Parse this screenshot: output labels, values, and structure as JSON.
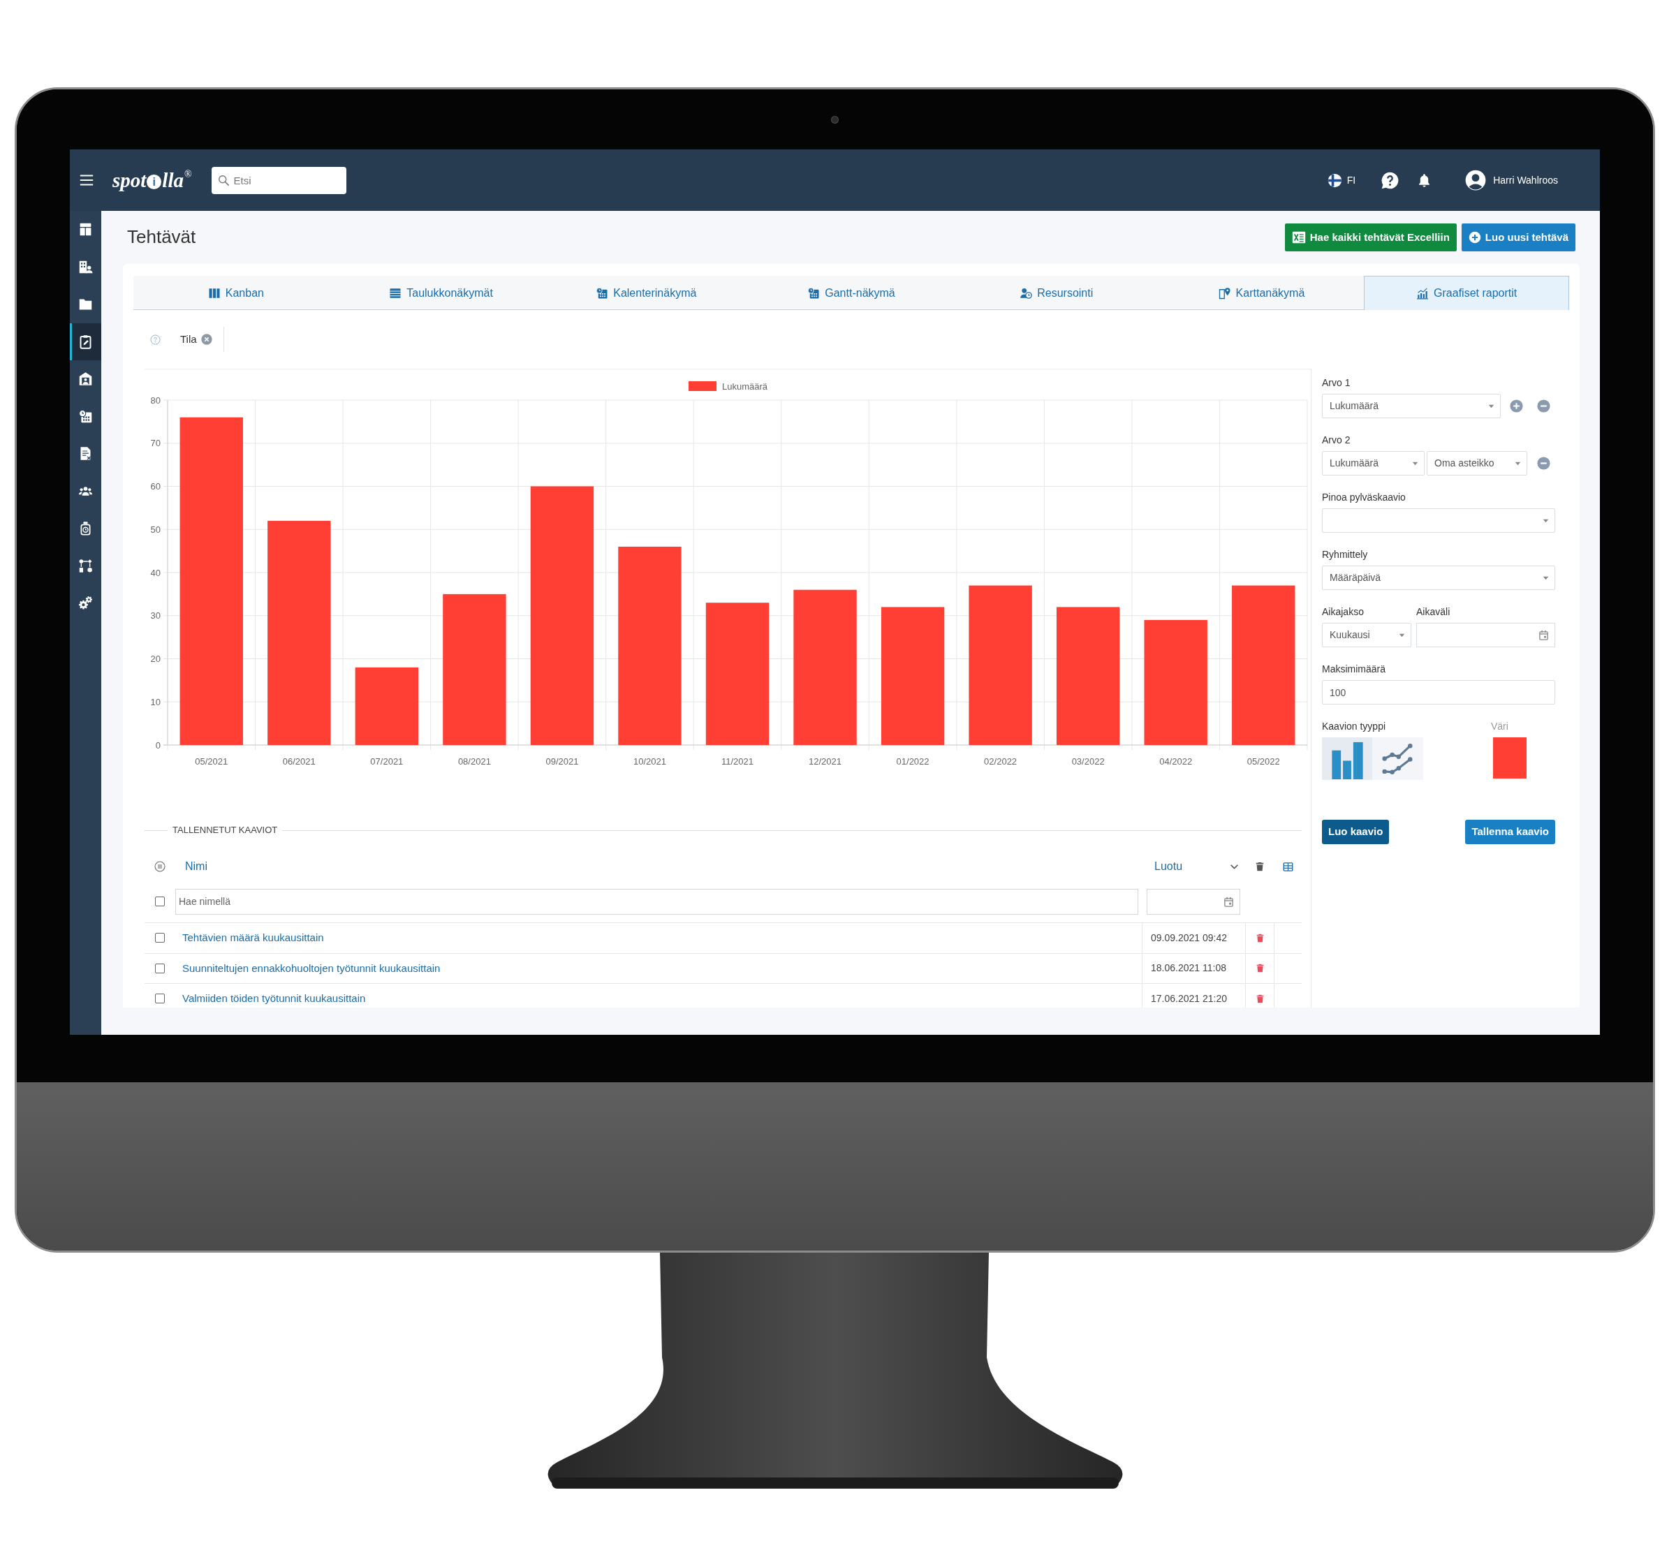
{
  "navbar": {
    "logo": {
      "parts": [
        {
          "text": "spot",
          "kind": "plain"
        },
        {
          "text": "i",
          "kind": "circled"
        },
        {
          "text": "lla",
          "kind": "plain"
        }
      ],
      "mark": "®"
    },
    "search": {
      "placeholder": "Etsi"
    },
    "language": "FI",
    "user": "Harri Wahlroos"
  },
  "sidebar": {
    "items": [
      {
        "selected": false
      },
      {
        "selected": false
      },
      {
        "selected": false
      },
      {
        "selected": true
      },
      {
        "selected": false
      },
      {
        "selected": false
      },
      {
        "selected": false
      },
      {
        "selected": false
      },
      {
        "selected": false
      },
      {
        "selected": false
      },
      {
        "selected": false
      }
    ]
  },
  "header": {
    "title": "Tehtävät",
    "buttons": [
      {
        "label": "Hae kaikki tehtävät Excelliin",
        "kind": "excel"
      },
      {
        "label": "Luo uusi tehtävä",
        "kind": "create"
      }
    ]
  },
  "tabs": [
    {
      "label": "Kanban",
      "selected": false
    },
    {
      "label": "Taulukkonäkymät",
      "selected": false
    },
    {
      "label": "Kalenterinäkymä",
      "selected": false
    },
    {
      "label": "Gantt-näkymä",
      "selected": false
    },
    {
      "label": "Resursointi",
      "selected": false
    },
    {
      "label": "Karttanäkymä",
      "selected": false
    },
    {
      "label": "Graafiset raportit",
      "selected": true
    }
  ],
  "filters": [
    {
      "label": "Tila"
    }
  ],
  "chart": {
    "chart_data": {
      "type": "bar",
      "categories": [
        "05/2021",
        "06/2021",
        "07/2021",
        "08/2021",
        "09/2021",
        "10/2021",
        "11/2021",
        "12/2021",
        "01/2022",
        "02/2022",
        "03/2022",
        "04/2022",
        "05/2022"
      ],
      "series": [
        {
          "name": "Lukumäärä",
          "color": "#ff3f33",
          "values": [
            76,
            52,
            18,
            35,
            60,
            46,
            33,
            36,
            32,
            37,
            32,
            29,
            37
          ]
        }
      ],
      "ylim": [
        0,
        80
      ],
      "yticks": [
        0,
        10,
        20,
        30,
        40,
        50,
        60,
        70,
        80
      ],
      "grid": true
    }
  },
  "saved_charts": {
    "title": "TALLENNETUT KAAVIOT",
    "columns": [
      {
        "label": "Nimi"
      },
      {
        "label": "Luotu"
      }
    ],
    "search": {
      "placeholder": "Hae nimellä"
    },
    "select_all": {
      "checked": false
    },
    "rows": [
      {
        "name": "Tehtävien määrä kuukausittain",
        "created": "09.09.2021 09:42",
        "checked": false
      },
      {
        "name": "Suunniteltujen ennakkohuoltojen työtunnit kuukausittain",
        "created": "18.06.2021 11:08",
        "checked": false
      },
      {
        "name": "Valmiiden töiden työtunnit kuukausittain",
        "created": "17.06.2021 21:20",
        "checked": false
      }
    ]
  },
  "settings": {
    "value_1": {
      "label": "Arvo 1",
      "value": "Lukumäärä"
    },
    "value_2": {
      "label": "Arvo 2",
      "value": "Lukumäärä",
      "scale": "Oma asteikko"
    },
    "stacking": {
      "label": "Pinoa pylväskaavio"
    },
    "grouping": {
      "label": "Ryhmittely",
      "value": "Määräpäivä"
    },
    "period": {
      "label": "Aikajakso",
      "value": "Kuukausi"
    },
    "range": {
      "label": "Aikaväli"
    },
    "max_count": {
      "label": "Maksimimäärä",
      "value": "100"
    },
    "chart_type": {
      "label": "Kaavion tyyppi",
      "options": [
        {
          "kind": "bar",
          "selected": true
        },
        {
          "kind": "line",
          "selected": false
        }
      ]
    },
    "color": {
      "label": "Väri",
      "color": "#ff3f33"
    },
    "buttons": [
      {
        "label": "Luo kaavio",
        "kind": "create"
      },
      {
        "label": "Tallenna kaavio",
        "kind": "save"
      }
    ]
  }
}
